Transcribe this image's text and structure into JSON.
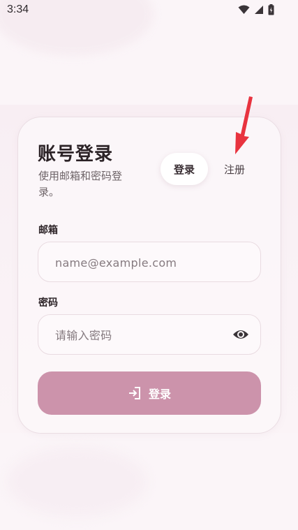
{
  "status_bar": {
    "time": "3:34",
    "icons": [
      "wifi-icon",
      "signal-icon",
      "battery-icon"
    ]
  },
  "login_card": {
    "title": "账号登录",
    "subtitle": "使用邮箱和密码登录。",
    "tabs": [
      {
        "label": "登录",
        "active": true
      },
      {
        "label": "注册",
        "active": false
      }
    ],
    "email": {
      "label": "邮箱",
      "placeholder": "name@example.com",
      "value": ""
    },
    "password": {
      "label": "密码",
      "placeholder": "请输入密码",
      "value": ""
    },
    "password_toggle_icon": "eye-icon",
    "submit": {
      "label": "登录",
      "icon": "login-arrow-icon"
    }
  },
  "annotation": {
    "type": "arrow",
    "color": "#e8333f"
  },
  "colors": {
    "accent": "#cc93ab",
    "background": "#fbf5f8",
    "text": "#2b2226"
  }
}
